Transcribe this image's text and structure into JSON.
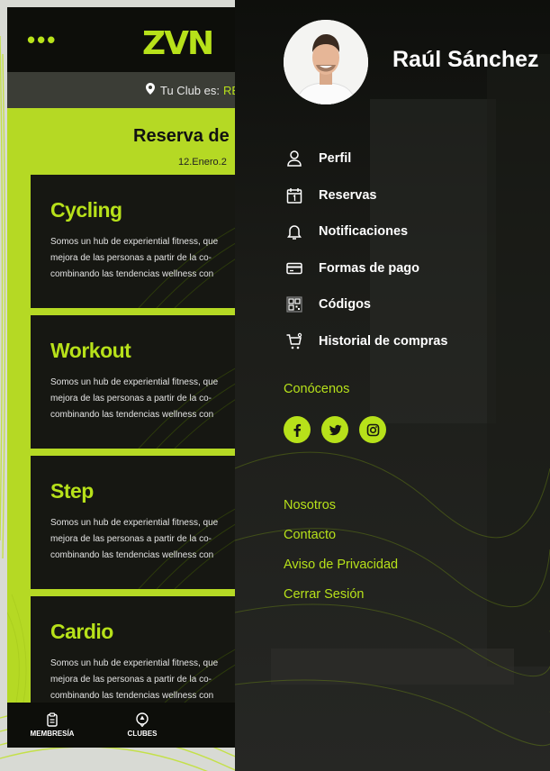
{
  "app": {
    "logo_text": "ZVN",
    "menu_dots": "•••",
    "club_label": "Tu Club es:",
    "club_name": "RE",
    "reservation_title": "Reserva de",
    "reservation_date": "12.Enero.2",
    "cards": [
      {
        "title": "Cycling",
        "text": "Somos un hub de experiential fitness, que\nmejora de las personas a partir de la co-\ncombinando las tendencias wellness con"
      },
      {
        "title": "Workout",
        "text": "Somos un hub de experiential fitness, que\nmejora de las personas a partir de la co-\ncombinando las tendencias wellness con"
      },
      {
        "title": "Step",
        "text": "Somos un hub de experiential fitness, que\nmejora de las personas a partir de la co-\ncombinando las tendencias wellness con"
      },
      {
        "title": "Cardio",
        "text": "Somos un hub de experiential fitness, que\nmejora de las personas a partir de la co-\ncombinando las tendencias wellness con"
      }
    ],
    "bottom_nav": [
      {
        "label": "MEMBRESÍA",
        "icon": "clipboard-icon"
      },
      {
        "label": "CLUBES",
        "icon": "location-pin-icon"
      }
    ]
  },
  "drawer": {
    "user_name": "Raúl Sánchez",
    "menu": [
      {
        "label": "Perfil",
        "icon": "user-icon"
      },
      {
        "label": "Reservas",
        "icon": "calendar-icon"
      },
      {
        "label": "Notificaciones",
        "icon": "bell-icon"
      },
      {
        "label": "Formas de pago",
        "icon": "credit-card-icon"
      },
      {
        "label": "Códigos",
        "icon": "qr-code-icon"
      },
      {
        "label": "Historial de compras",
        "icon": "cart-icon"
      }
    ],
    "social_title": "Conócenos",
    "socials": [
      "facebook-icon",
      "twitter-icon",
      "instagram-icon"
    ],
    "links": [
      "Nosotros",
      "Contacto",
      "Aviso de Privacidad",
      "Cerrar Sesión"
    ]
  },
  "colors": {
    "accent": "#b7e11a",
    "dark": "#151613",
    "green_panel": "#b5d924"
  }
}
